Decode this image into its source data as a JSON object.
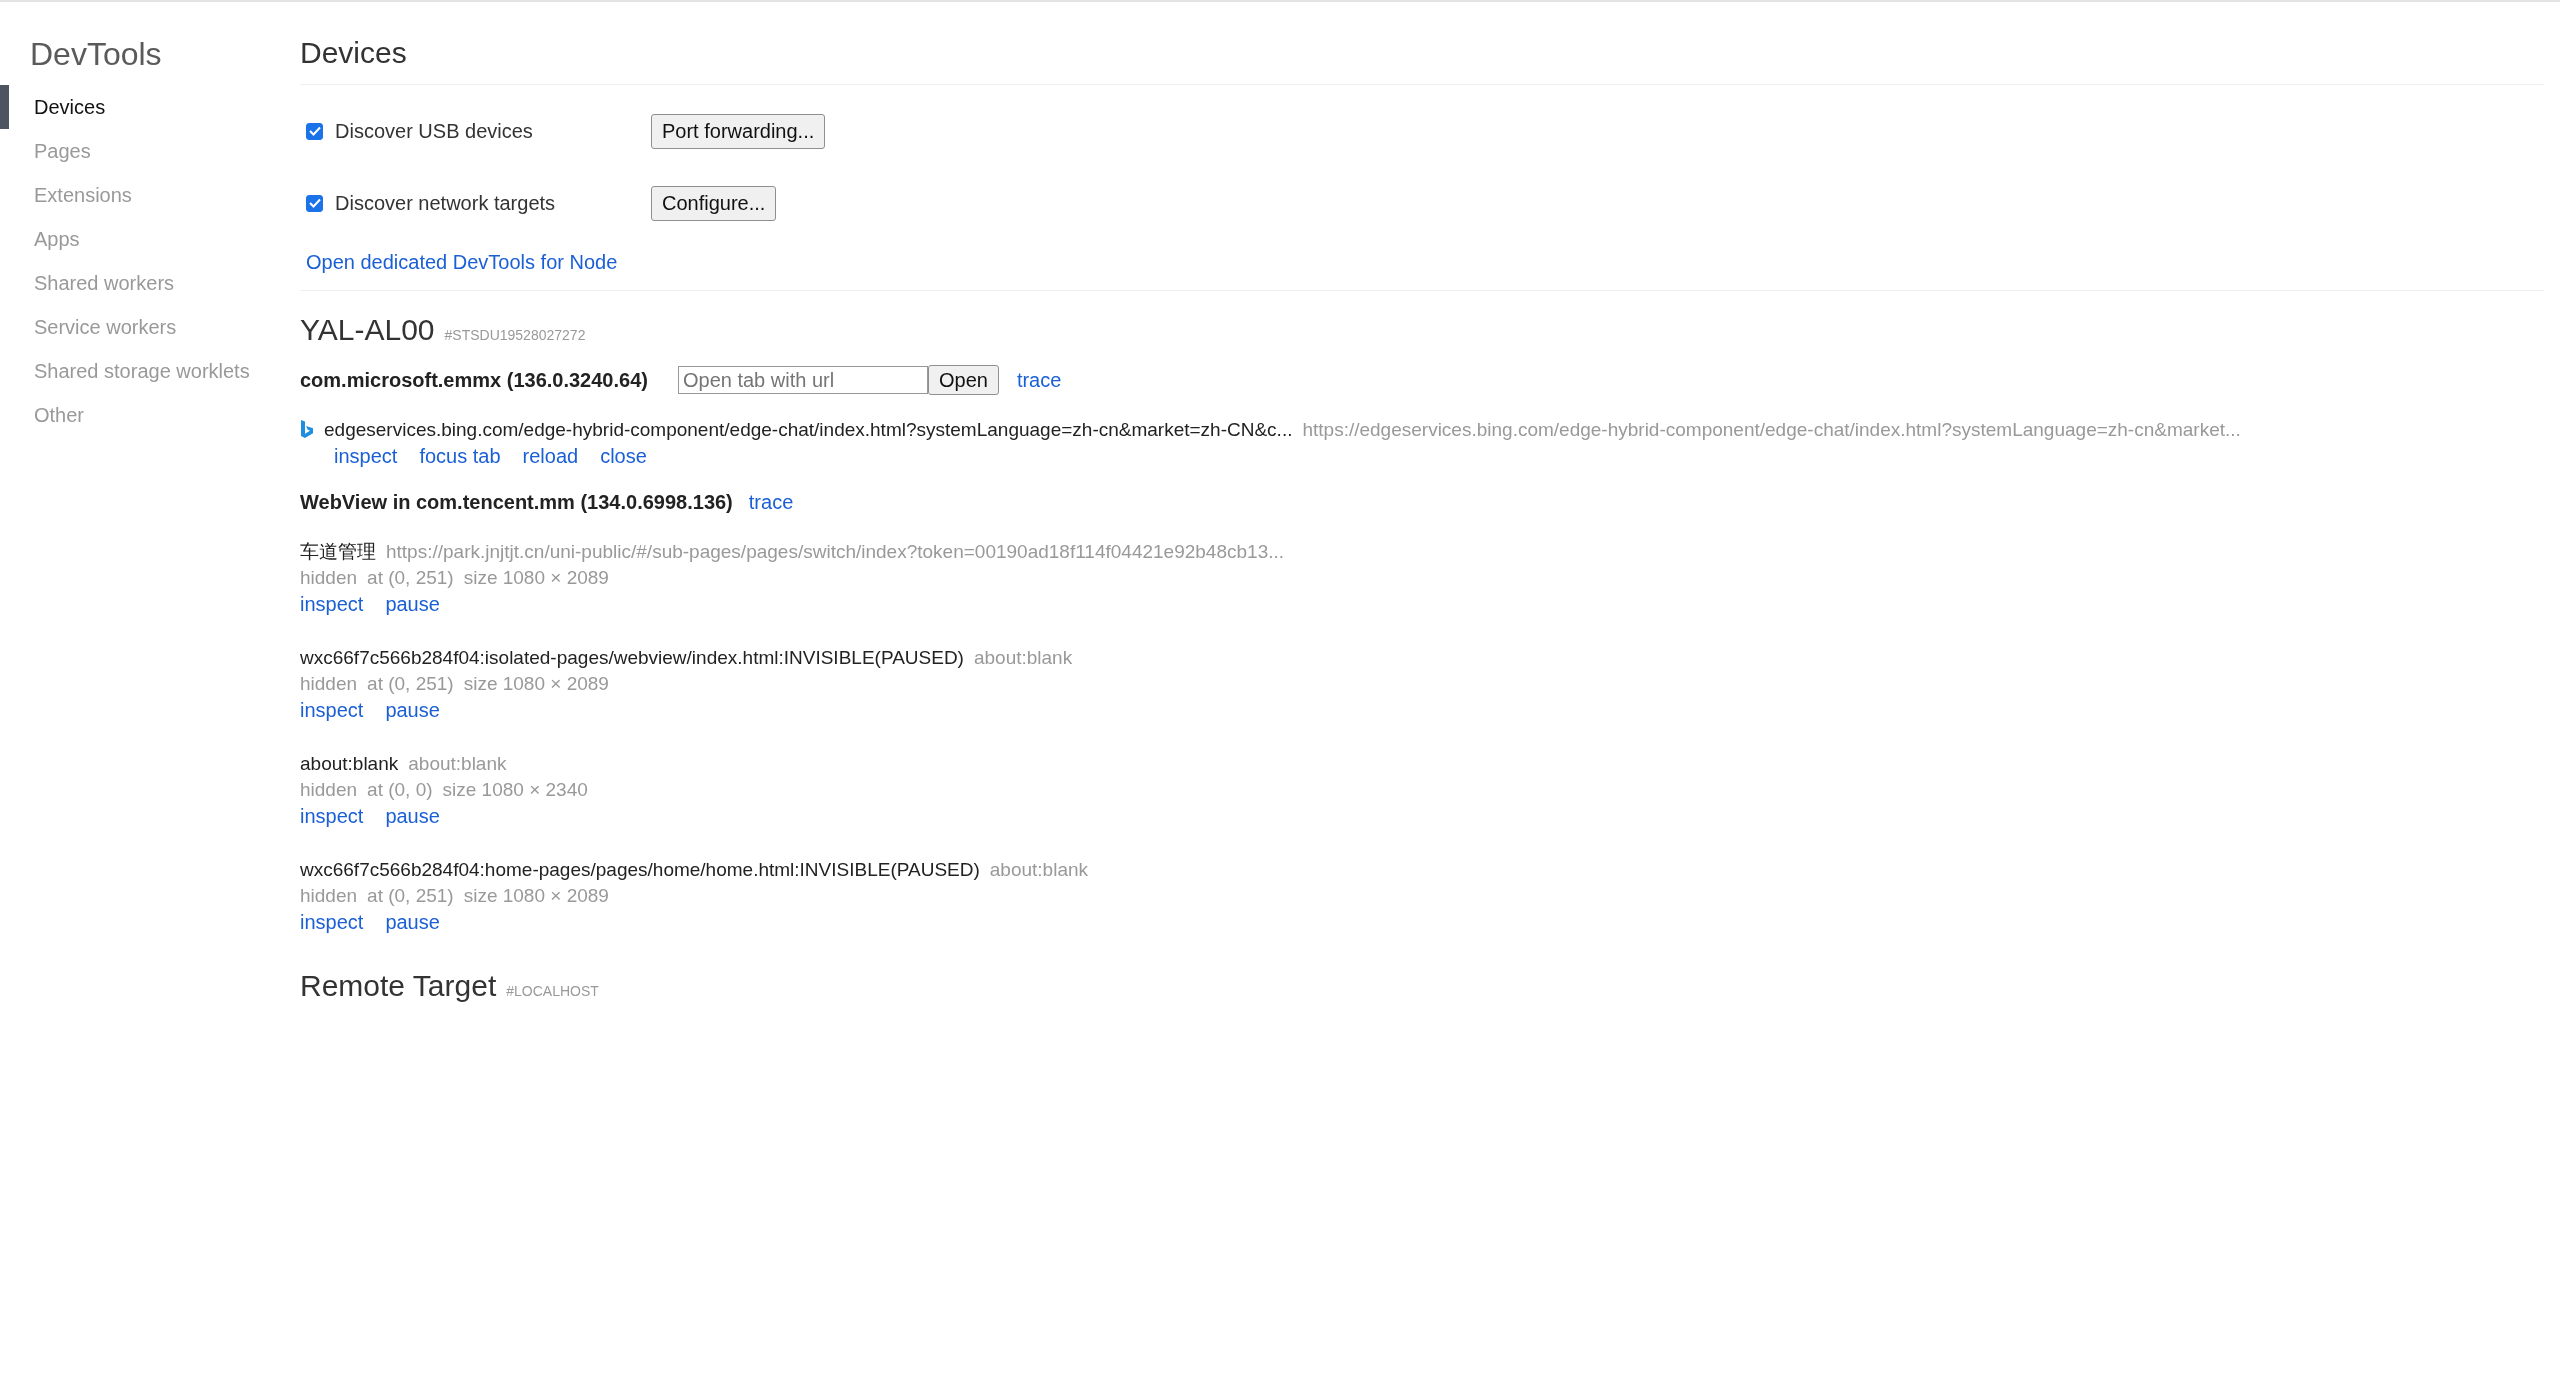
{
  "sidebar": {
    "title": "DevTools",
    "items": [
      {
        "label": "Devices",
        "selected": true
      },
      {
        "label": "Pages",
        "selected": false
      },
      {
        "label": "Extensions",
        "selected": false
      },
      {
        "label": "Apps",
        "selected": false
      },
      {
        "label": "Shared workers",
        "selected": false
      },
      {
        "label": "Service workers",
        "selected": false
      },
      {
        "label": "Shared storage worklets",
        "selected": false
      },
      {
        "label": "Other",
        "selected": false
      }
    ]
  },
  "content": {
    "title": "Devices",
    "options": [
      {
        "label": "Discover USB devices",
        "checked": true,
        "button": "Port forwarding..."
      },
      {
        "label": "Discover network targets",
        "checked": true,
        "button": "Configure..."
      }
    ],
    "node_link": "Open dedicated DevTools for Node"
  },
  "devices": [
    {
      "name": "YAL-AL00",
      "serial": "#STSDU19528027272",
      "browsers": [
        {
          "name": "com.microsoft.emmx (136.0.3240.64)",
          "url_input": {
            "placeholder": "Open tab with url"
          },
          "open_button": "Open",
          "trace": "trace",
          "pages": [
            {
              "kind": "tab",
              "title": "edgeservices.bing.com/edge-hybrid-component/edge-chat/index.html?systemLanguage=zh-cn&market=zh-CN&c...",
              "url": "https://edgeservices.bing.com/edge-hybrid-component/edge-chat/index.html?systemLanguage=zh-cn&market...",
              "actions": [
                "inspect",
                "focus tab",
                "reload",
                "close"
              ]
            }
          ]
        },
        {
          "name": "WebView in com.tencent.mm (134.0.6998.136)",
          "trace": "trace",
          "pages": [
            {
              "kind": "webview",
              "title": "车道管理",
              "url": "https://park.jnjtjt.cn/uni-public/#/sub-pages/pages/switch/index?token=00190ad18f114f04421e92b48cb13...",
              "status": "hidden",
              "position": "at (0, 251)",
              "size": "size 1080 × 2089",
              "actions": [
                "inspect",
                "pause"
              ]
            },
            {
              "kind": "webview",
              "title": "wxc66f7c566b284f04:isolated-pages/webview/index.html:INVISIBLE(PAUSED)",
              "url": "about:blank",
              "status": "hidden",
              "position": "at (0, 251)",
              "size": "size 1080 × 2089",
              "actions": [
                "inspect",
                "pause"
              ]
            },
            {
              "kind": "webview",
              "title": "about:blank",
              "url": "about:blank",
              "status": "hidden",
              "position": "at (0, 0)",
              "size": "size 1080 × 2340",
              "actions": [
                "inspect",
                "pause"
              ]
            },
            {
              "kind": "webview",
              "title": "wxc66f7c566b284f04:home-pages/pages/home/home.html:INVISIBLE(PAUSED)",
              "url": "about:blank",
              "status": "hidden",
              "position": "at (0, 251)",
              "size": "size 1080 × 2089",
              "actions": [
                "inspect",
                "pause"
              ]
            }
          ]
        }
      ]
    },
    {
      "name": "Remote Target",
      "serial": "#LOCALHOST"
    }
  ]
}
